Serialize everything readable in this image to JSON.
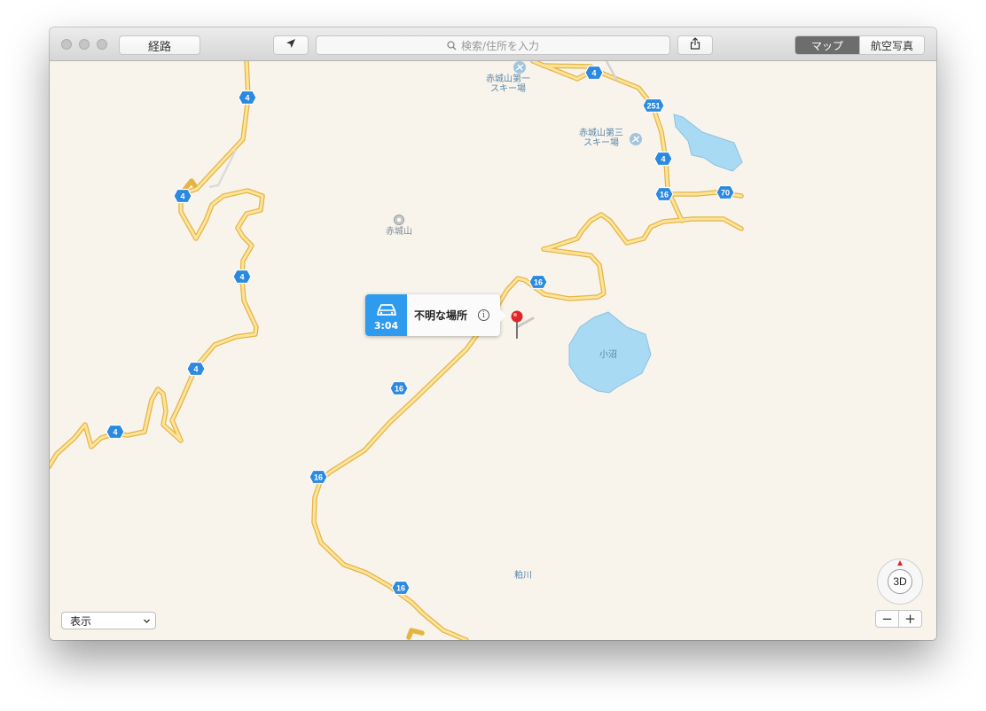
{
  "toolbar": {
    "directions_label": "経路",
    "location_icon": "location-arrow-icon",
    "search_placeholder": "検索/住所を入力",
    "share_icon": "share-icon",
    "map_mode_label": "マップ",
    "satellite_mode_label": "航空写真"
  },
  "map": {
    "place_labels": {
      "ski1": "赤城山第一\nスキー場",
      "ski3": "赤城山第三\nスキー場",
      "akagiyama": "赤城山",
      "konuma": "小沼",
      "kasukawa": "粕川"
    },
    "route_shields": [
      "4",
      "251",
      "4",
      "16",
      "70",
      "4",
      "4",
      "16",
      "4",
      "16",
      "4",
      "16",
      "16"
    ],
    "callout": {
      "eta": "3:04",
      "title": "不明な場所",
      "info_icon": "info-icon"
    },
    "colors": {
      "road": "#f4c95b",
      "water": "#a8daf3",
      "shield": "#2b8ae0",
      "accent": "#2e9bef",
      "pin": "#e0262b"
    }
  },
  "controls": {
    "view_select_label": "表示",
    "compass_label": "3D",
    "zoom_out_label": "−",
    "zoom_in_label": "+"
  }
}
